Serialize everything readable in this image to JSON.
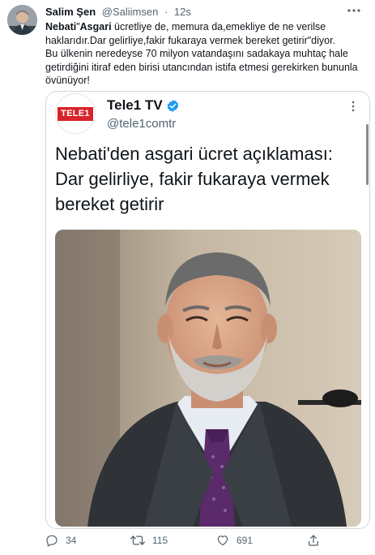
{
  "tweet": {
    "display_name": "Salim Şen",
    "handle": "@Saliimsen",
    "separator": "·",
    "time": "12s",
    "text_mention": "Nebati",
    "text_line1_quote": "\"",
    "text_line1_bold": "Asgari",
    "text_line1_rest": " ücretliye de, memura da,emekliye de ne verilse haklarıdır.Dar gelirliye,fakir fukaraya vermek bereket getirir\"diyor.",
    "text_line2": "Bu ülkenin neredeyse 70 milyon vatandaşını sadakaya muhtaç hale getirdiğini itiraf eden birisi utancından istifa etmesi gerekirken bununla övünüyor!"
  },
  "quote": {
    "logo_text": "TELE1",
    "name": "Tele1 TV",
    "handle": "@tele1comtr",
    "headline": "Nebati'den asgari ücret açıklaması: Dar gelirliye, fakir fukaraya vermek bereket getirir"
  },
  "actions": {
    "reply_count": "34",
    "retweet_count": "115",
    "like_count": "691"
  },
  "colors": {
    "text_primary": "#0f1419",
    "text_secondary": "#536471",
    "border": "#cfd9de",
    "verified": "#1d9bf0",
    "tele1_red": "#d8232a"
  },
  "icons": {
    "more": "more-dots-icon",
    "verified": "verified-badge-icon",
    "reply": "reply-icon",
    "retweet": "retweet-icon",
    "like": "heart-icon",
    "share": "share-icon"
  }
}
